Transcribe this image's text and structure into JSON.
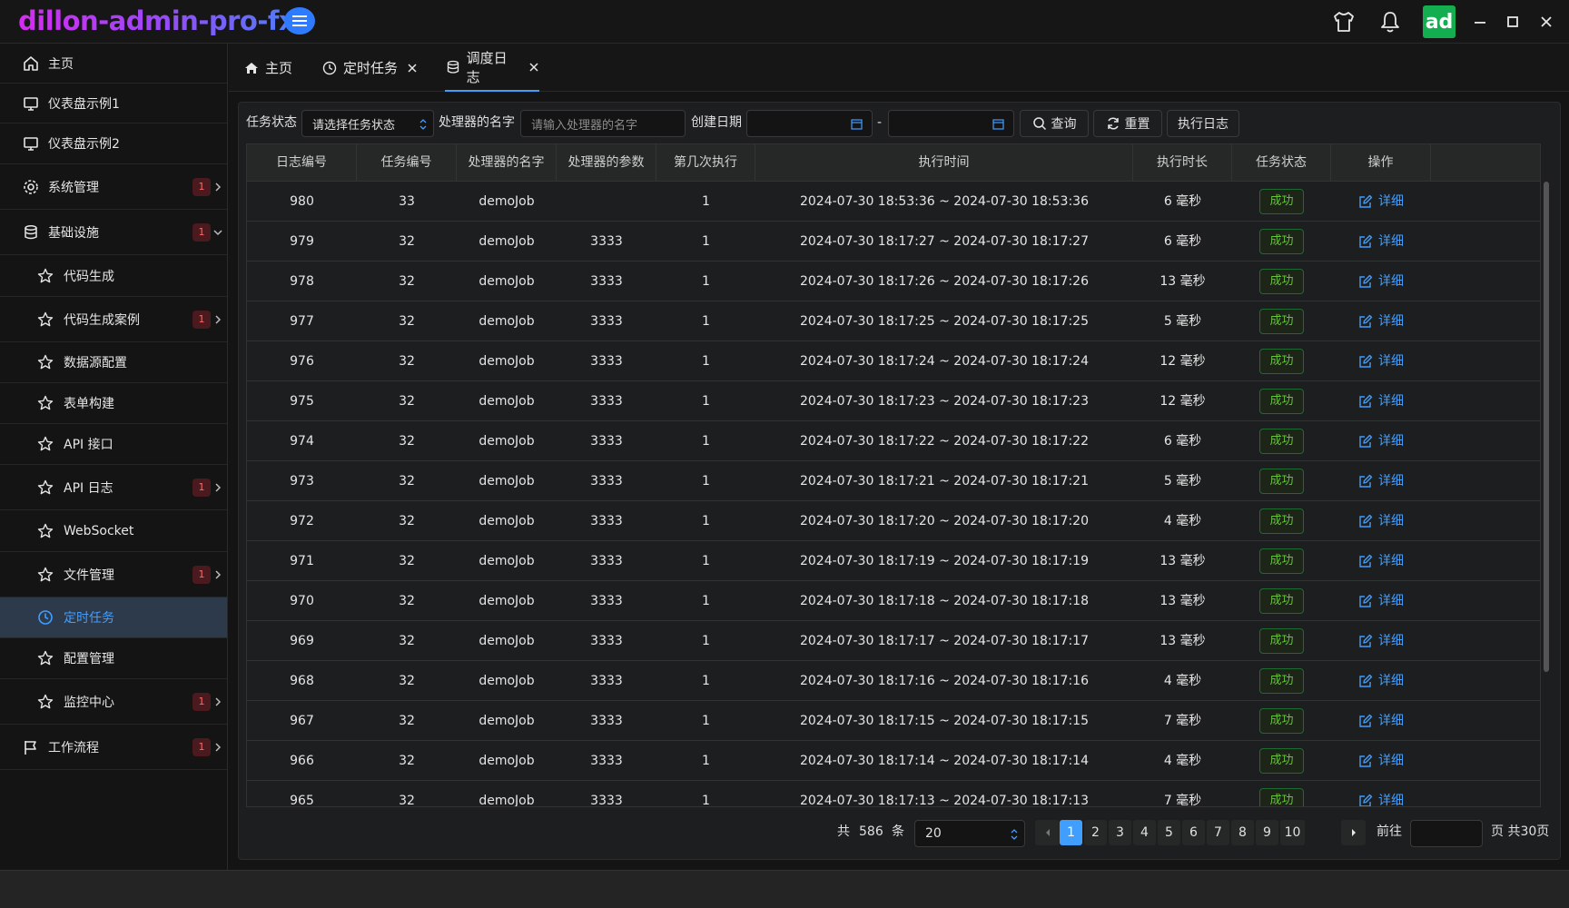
{
  "app": {
    "title": "dillon-admin-pro-fx",
    "avatar_text": "ad"
  },
  "sidebar": {
    "items": [
      {
        "label": "主页",
        "icon": "home-icon",
        "badge": ""
      },
      {
        "label": "仪表盘示例1",
        "icon": "monitor-icon",
        "badge": ""
      },
      {
        "label": "仪表盘示例2",
        "icon": "monitor-icon",
        "badge": ""
      },
      {
        "label": "系统管理",
        "icon": "gear-icon",
        "badge": "1"
      },
      {
        "label": "基础设施",
        "icon": "database-icon",
        "badge": "1"
      },
      {
        "label": "代码生成",
        "icon": "star-icon",
        "badge": ""
      },
      {
        "label": "代码生成案例",
        "icon": "star-icon",
        "badge": "1"
      },
      {
        "label": "数据源配置",
        "icon": "star-icon",
        "badge": ""
      },
      {
        "label": "表单构建",
        "icon": "star-icon",
        "badge": ""
      },
      {
        "label": "API 接口",
        "icon": "star-icon",
        "badge": ""
      },
      {
        "label": "API 日志",
        "icon": "star-icon",
        "badge": "1"
      },
      {
        "label": "WebSocket",
        "icon": "star-icon",
        "badge": ""
      },
      {
        "label": "文件管理",
        "icon": "star-icon",
        "badge": "1"
      },
      {
        "label": "定时任务",
        "icon": "clock-icon",
        "badge": ""
      },
      {
        "label": "配置管理",
        "icon": "star-icon",
        "badge": ""
      },
      {
        "label": "监控中心",
        "icon": "star-icon",
        "badge": "1"
      },
      {
        "label": "工作流程",
        "icon": "flag-icon",
        "badge": "1"
      }
    ],
    "active": "定时任务"
  },
  "tabs": [
    {
      "label": "主页",
      "icon": "home-icon",
      "closable": false
    },
    {
      "label": "定时任务",
      "icon": "clock-icon",
      "closable": true
    },
    {
      "label": "调度日志",
      "icon": "database-icon",
      "closable": true,
      "active": true
    }
  ],
  "filters": {
    "status_label": "任务状态",
    "status_select": "请选择任务状态",
    "handler_label": "处理器的名字",
    "handler_placeholder": "请输入处理器的名字",
    "date_label": "创建日期",
    "date_sep": "-",
    "query_btn": "查询",
    "reset_btn": "重置",
    "exec_log_btn": "执行日志"
  },
  "table": {
    "columns": [
      "日志编号",
      "任务编号",
      "处理器的名字",
      "处理器的参数",
      "第几次执行",
      "执行时间",
      "执行时长",
      "任务状态",
      "操作"
    ],
    "detail_label": "详细",
    "rows": [
      [
        "980",
        "33",
        "demoJob",
        "",
        "1",
        "2024-07-30 18:53:36 ~ 2024-07-30 18:53:36",
        "6 毫秒",
        "成功"
      ],
      [
        "979",
        "32",
        "demoJob",
        "3333",
        "1",
        "2024-07-30 18:17:27 ~ 2024-07-30 18:17:27",
        "6 毫秒",
        "成功"
      ],
      [
        "978",
        "32",
        "demoJob",
        "3333",
        "1",
        "2024-07-30 18:17:26 ~ 2024-07-30 18:17:26",
        "13 毫秒",
        "成功"
      ],
      [
        "977",
        "32",
        "demoJob",
        "3333",
        "1",
        "2024-07-30 18:17:25 ~ 2024-07-30 18:17:25",
        "5 毫秒",
        "成功"
      ],
      [
        "976",
        "32",
        "demoJob",
        "3333",
        "1",
        "2024-07-30 18:17:24 ~ 2024-07-30 18:17:24",
        "12 毫秒",
        "成功"
      ],
      [
        "975",
        "32",
        "demoJob",
        "3333",
        "1",
        "2024-07-30 18:17:23 ~ 2024-07-30 18:17:23",
        "12 毫秒",
        "成功"
      ],
      [
        "974",
        "32",
        "demoJob",
        "3333",
        "1",
        "2024-07-30 18:17:22 ~ 2024-07-30 18:17:22",
        "6 毫秒",
        "成功"
      ],
      [
        "973",
        "32",
        "demoJob",
        "3333",
        "1",
        "2024-07-30 18:17:21 ~ 2024-07-30 18:17:21",
        "5 毫秒",
        "成功"
      ],
      [
        "972",
        "32",
        "demoJob",
        "3333",
        "1",
        "2024-07-30 18:17:20 ~ 2024-07-30 18:17:20",
        "4 毫秒",
        "成功"
      ],
      [
        "971",
        "32",
        "demoJob",
        "3333",
        "1",
        "2024-07-30 18:17:19 ~ 2024-07-30 18:17:19",
        "13 毫秒",
        "成功"
      ],
      [
        "970",
        "32",
        "demoJob",
        "3333",
        "1",
        "2024-07-30 18:17:18 ~ 2024-07-30 18:17:18",
        "13 毫秒",
        "成功"
      ],
      [
        "969",
        "32",
        "demoJob",
        "3333",
        "1",
        "2024-07-30 18:17:17 ~ 2024-07-30 18:17:17",
        "13 毫秒",
        "成功"
      ],
      [
        "968",
        "32",
        "demoJob",
        "3333",
        "1",
        "2024-07-30 18:17:16 ~ 2024-07-30 18:17:16",
        "4 毫秒",
        "成功"
      ],
      [
        "967",
        "32",
        "demoJob",
        "3333",
        "1",
        "2024-07-30 18:17:15 ~ 2024-07-30 18:17:15",
        "7 毫秒",
        "成功"
      ],
      [
        "966",
        "32",
        "demoJob",
        "3333",
        "1",
        "2024-07-30 18:17:14 ~ 2024-07-30 18:17:14",
        "4 毫秒",
        "成功"
      ],
      [
        "965",
        "32",
        "demoJob",
        "3333",
        "1",
        "2024-07-30 18:17:13 ~ 2024-07-30 18:17:13",
        "7 毫秒",
        "成功"
      ]
    ]
  },
  "pagination": {
    "total_prefix": "共",
    "total": "586",
    "total_suffix": "条",
    "page_size": "20",
    "pages": [
      "1",
      "2",
      "3",
      "4",
      "5",
      "6",
      "7",
      "8",
      "9",
      "10"
    ],
    "current": "1",
    "goto_label": "前往",
    "page_suffix": "页 共30页"
  },
  "colors": {
    "accent": "#409eff",
    "success": "#67c23a",
    "brand_avatar": "#13ae4f"
  }
}
